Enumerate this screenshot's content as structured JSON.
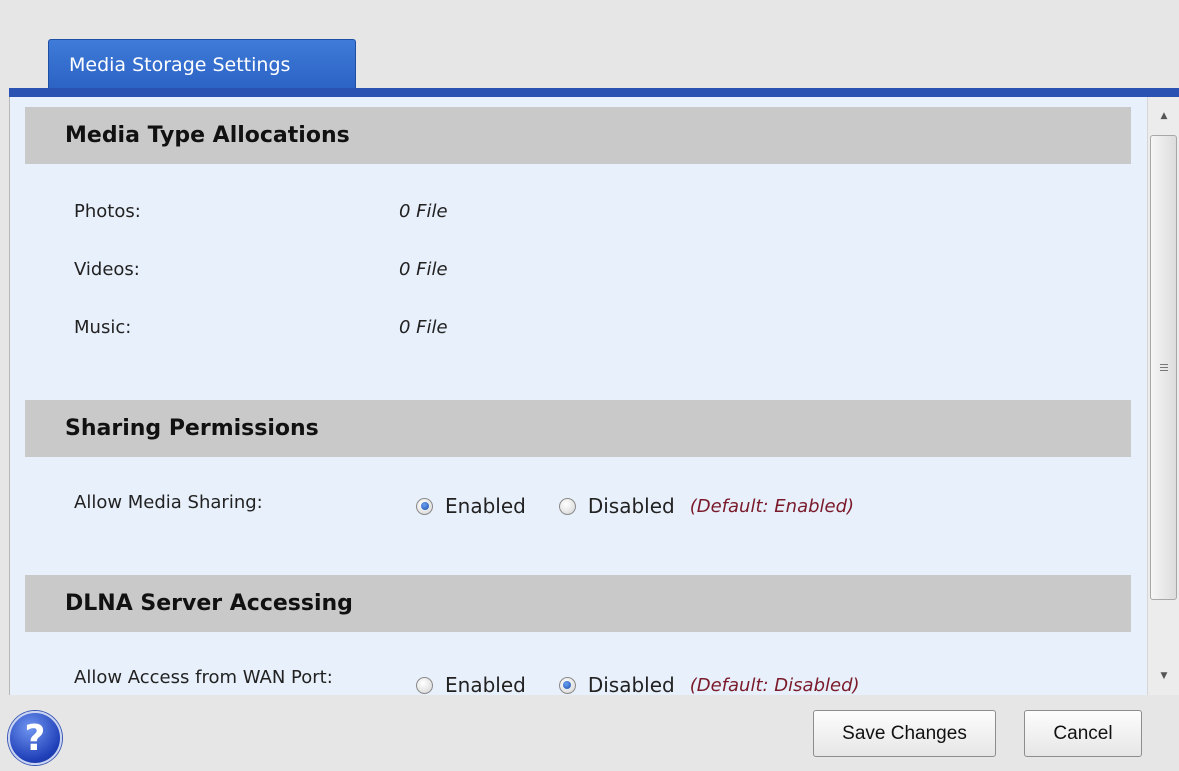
{
  "tab": {
    "label": "Media Storage Settings"
  },
  "sections": {
    "media": {
      "title": "Media Type Allocations",
      "rows": [
        {
          "label": "Photos:",
          "value": "0 File"
        },
        {
          "label": "Videos:",
          "value": "0 File"
        },
        {
          "label": "Music:",
          "value": "0 File"
        }
      ]
    },
    "sharing": {
      "title": "Sharing Permissions",
      "label": "Allow Media Sharing:",
      "options": [
        "Enabled",
        "Disabled"
      ],
      "selected": "Enabled",
      "default_note": "(Default: Enabled)"
    },
    "dlna": {
      "title": "DLNA Server Accessing",
      "label": "Allow Access from WAN Port:",
      "options": [
        "Enabled",
        "Disabled"
      ],
      "selected": "Disabled",
      "default_note": "(Default: Disabled)"
    }
  },
  "footer": {
    "help_symbol": "?",
    "save_label": "Save Changes",
    "cancel_label": "Cancel"
  },
  "scrollbar": {
    "up_arrow": "▲",
    "down_arrow": "▼"
  },
  "colors": {
    "tab_blue": "#2b62c4",
    "panel_bg": "#e8f0fb",
    "section_header": "#c9c9c9",
    "default_note": "#7a1a2a"
  }
}
